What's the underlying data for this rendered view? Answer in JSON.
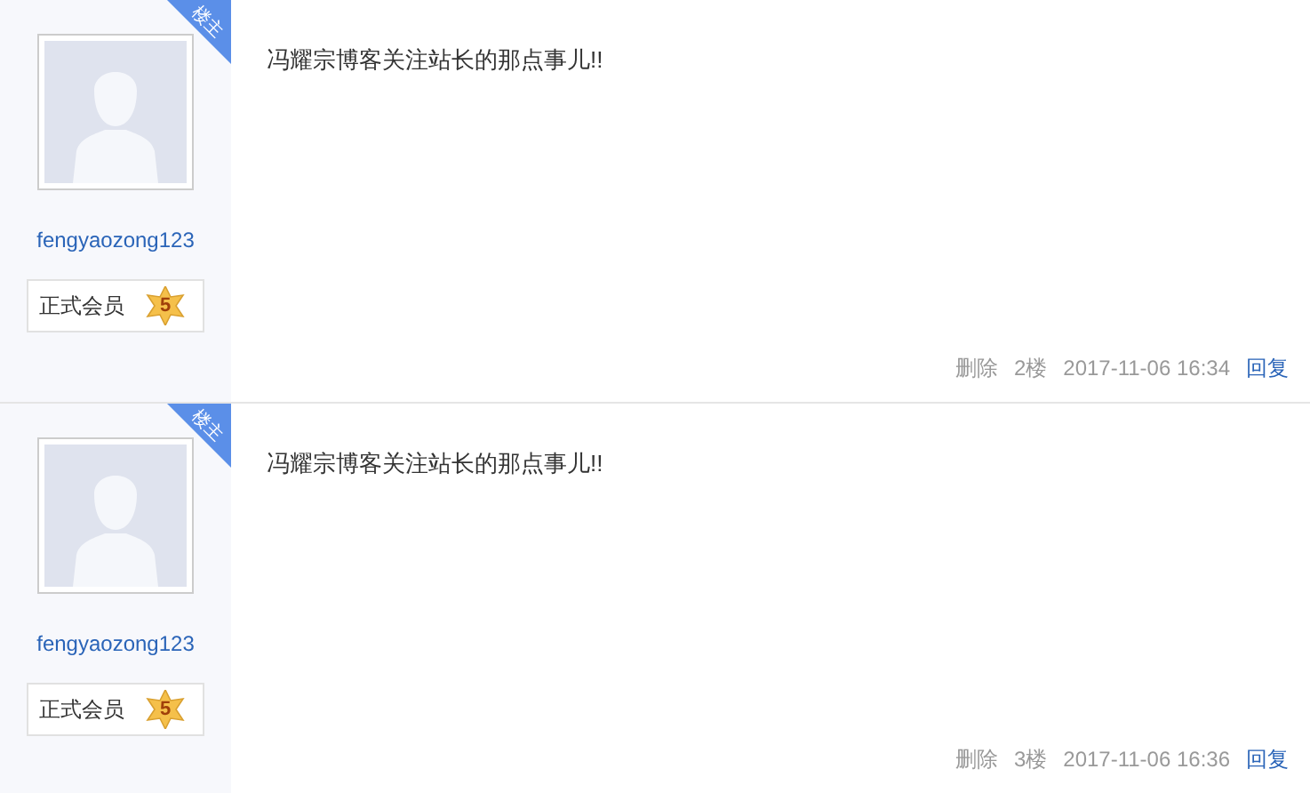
{
  "posts": [
    {
      "badge": "楼主",
      "username": "fengyaozong123",
      "member_title": "正式会员",
      "level": "5",
      "content": "冯耀宗博客关注站长的那点事儿!!",
      "delete": "删除",
      "floor": "2楼",
      "time": "2017-11-06 16:34",
      "reply": "回复"
    },
    {
      "badge": "楼主",
      "username": "fengyaozong123",
      "member_title": "正式会员",
      "level": "5",
      "content": "冯耀宗博客关注站长的那点事儿!!",
      "delete": "删除",
      "floor": "3楼",
      "time": "2017-11-06 16:36",
      "reply": "回复"
    }
  ]
}
